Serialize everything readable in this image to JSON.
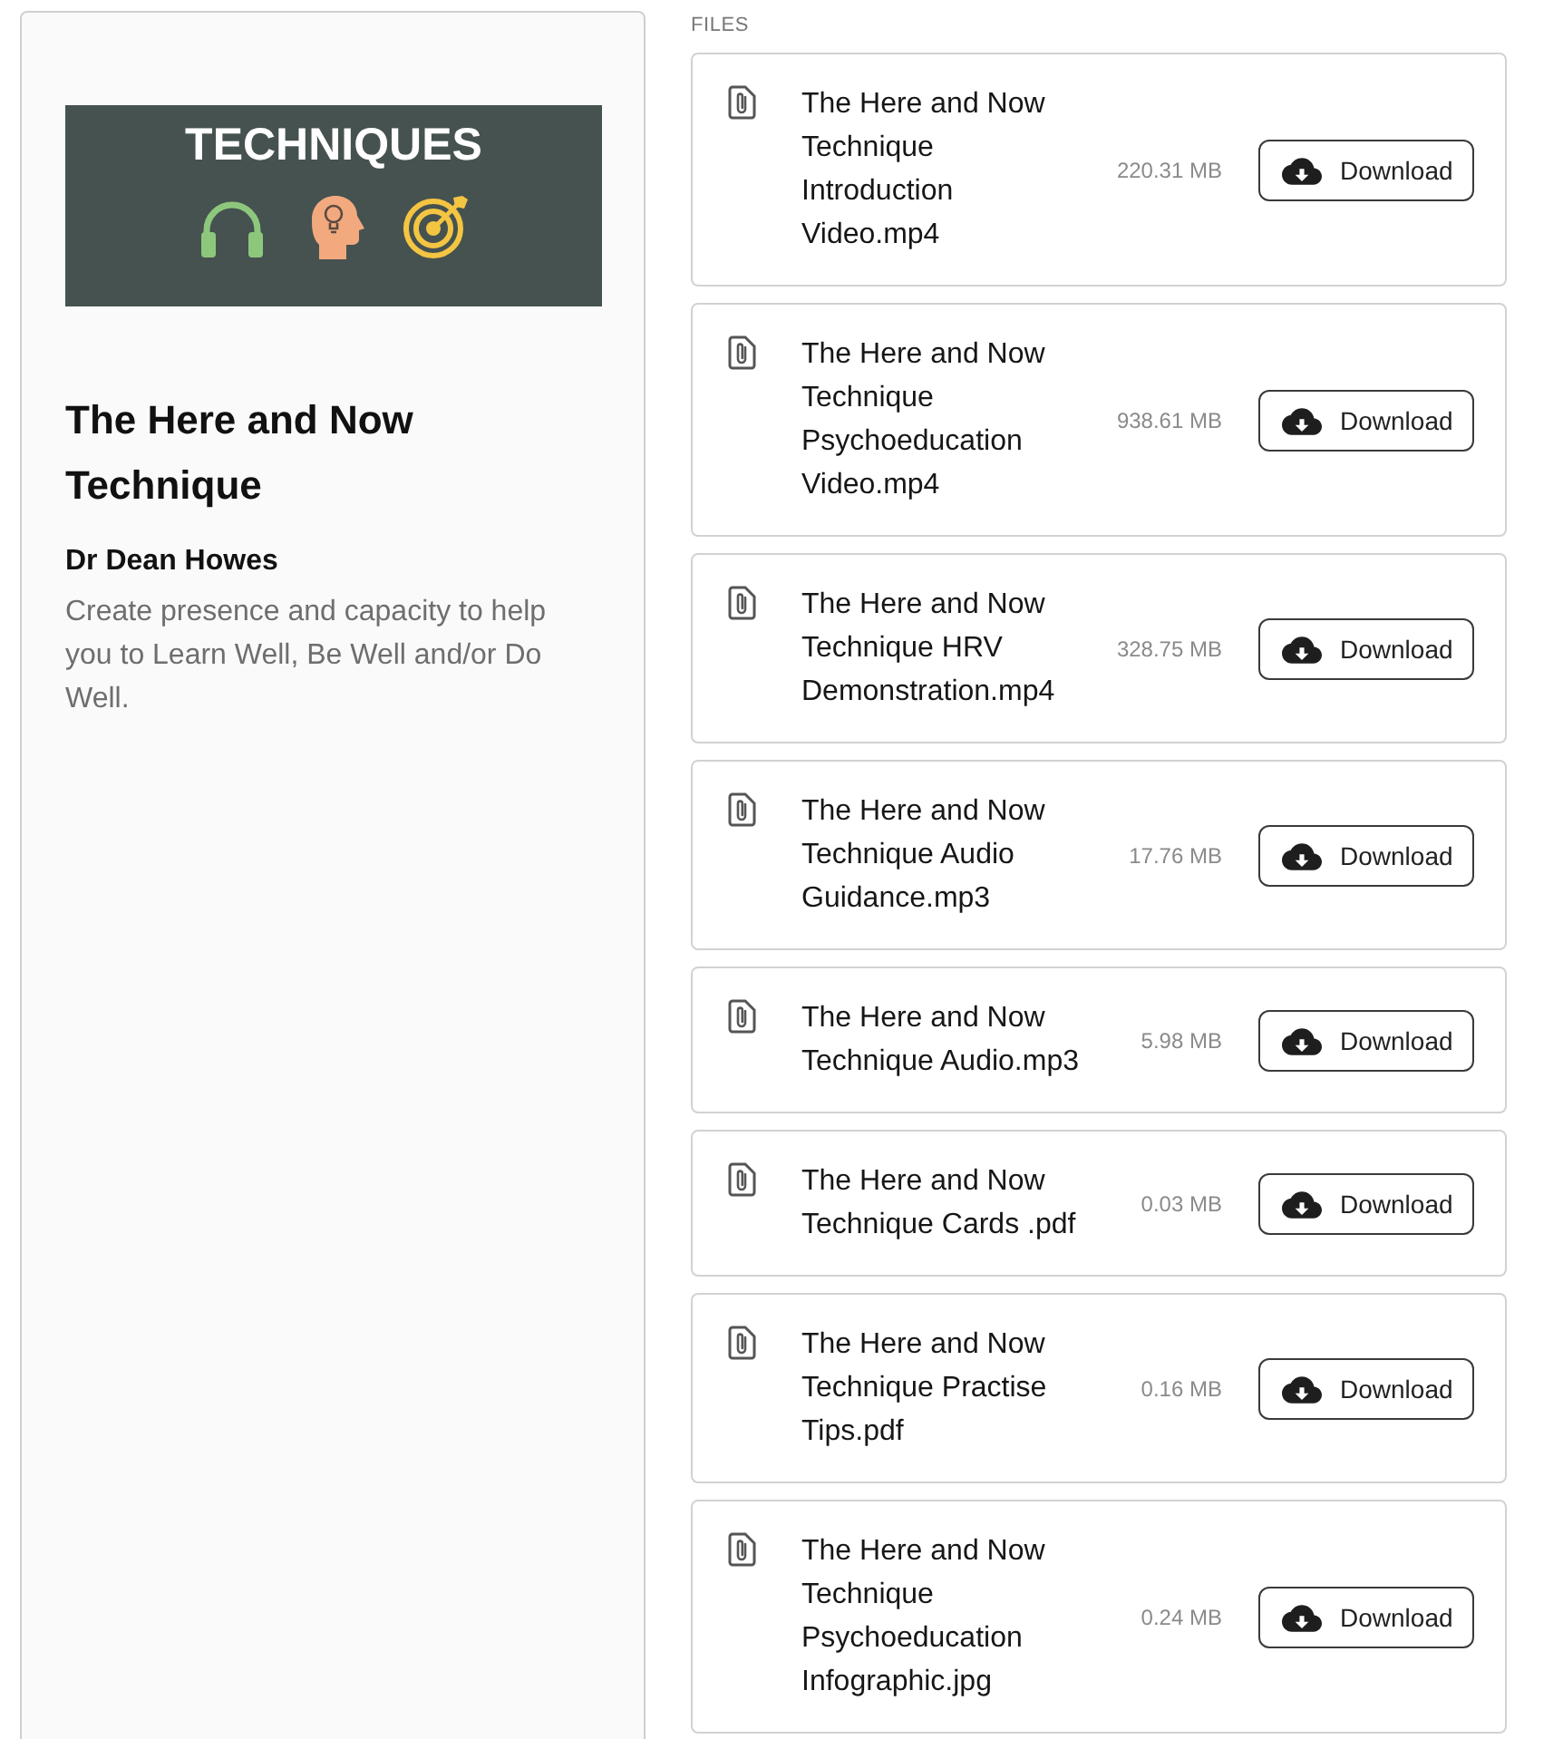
{
  "course": {
    "banner": {
      "title": "TECHNIQUES"
    },
    "title": "The Here and Now Technique",
    "author": "Dr Dean Howes",
    "description": "Create presence and capacity to help you to Learn Well, Be Well and/or Do Well."
  },
  "files": {
    "heading": "FILES",
    "items": [
      {
        "name": "The Here and Now Technique Introduction Video.mp4",
        "size": "220.31 MB",
        "button": "Download"
      },
      {
        "name": "The Here and Now Technique Psychoeducation Video.mp4",
        "size": "938.61 MB",
        "button": "Download"
      },
      {
        "name": "The Here and Now Technique HRV Demonstration.mp4",
        "size": "328.75 MB",
        "button": "Download"
      },
      {
        "name": "The Here and Now Technique Audio Guidance.mp3",
        "size": "17.76 MB",
        "button": "Download"
      },
      {
        "name": "The Here and Now Technique Audio.mp3",
        "size": "5.98 MB",
        "button": "Download"
      },
      {
        "name": "The Here and Now Technique Cards .pdf",
        "size": "0.03 MB",
        "button": "Download"
      },
      {
        "name": "The Here and Now Technique Practise Tips.pdf",
        "size": "0.16 MB",
        "button": "Download"
      },
      {
        "name": "The Here and Now Technique Psychoeducation Infographic.jpg",
        "size": "0.24 MB",
        "button": "Download"
      }
    ]
  }
}
